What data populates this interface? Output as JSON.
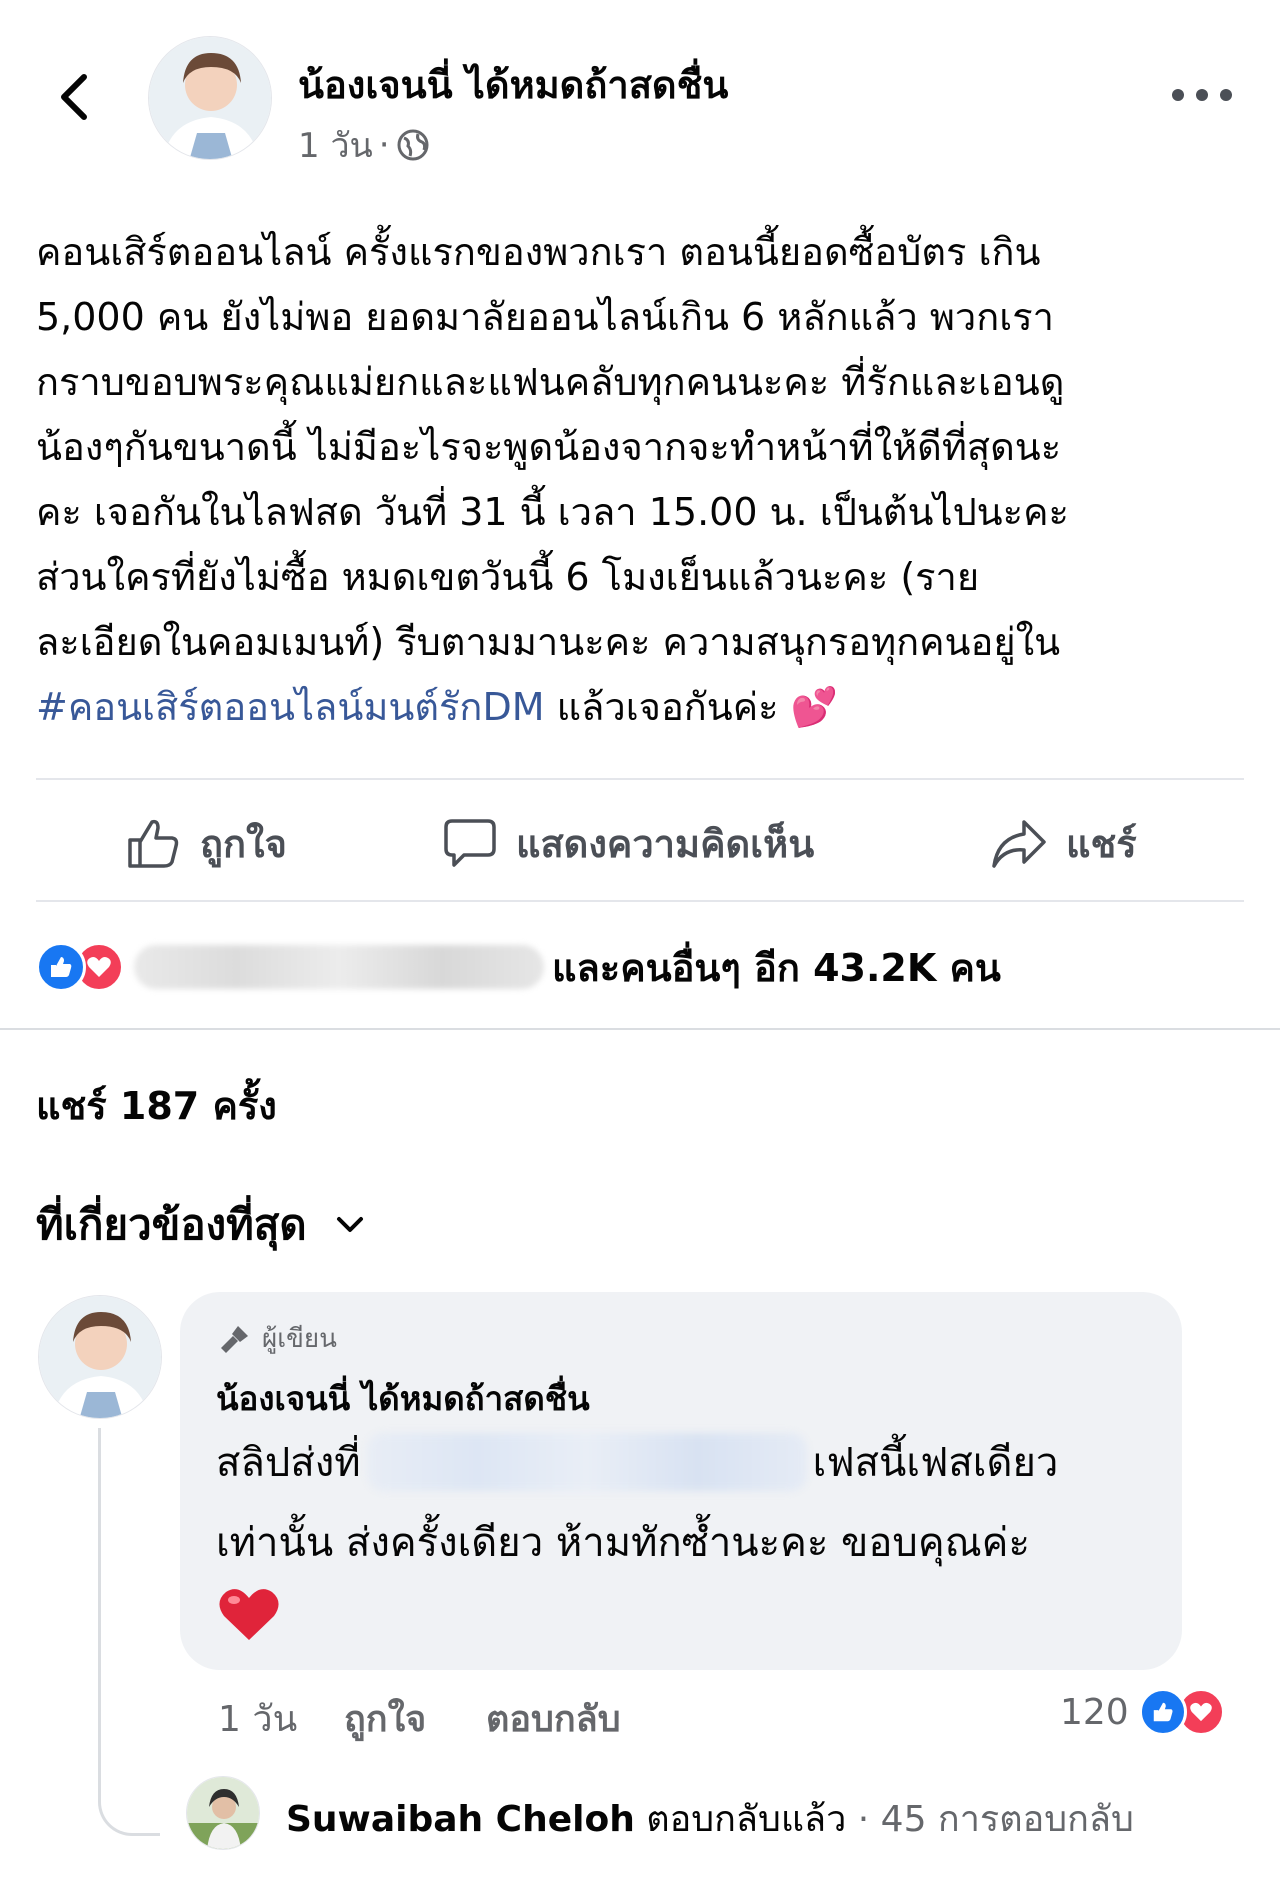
{
  "header": {
    "back_icon": "chevron-left-icon",
    "author_name": "น้องเจนนี่ ได้หมดถ้าสดชื่น",
    "time": "1 วัน",
    "separator": "·",
    "privacy_icon": "globe-icon",
    "more_icon": "more-horizontal-icon"
  },
  "post": {
    "lines": [
      "คอนเสิร์ตออนไลน์ ครั้งแรกของพวกเรา ตอนนี้ยอดซื้อบัตร เกิน",
      "5,000 คน ยังไม่พอ ยอดมาลัยออนไลน์เกิน 6 หลักแล้ว พวกเรา",
      "กราบขอบพระคุณแม่ยกและแฟนคลับทุกคนนะคะ ที่รักและเอนดู",
      "น้องๆกันขนาดนี้ ไม่มีอะไรจะพูดน้องจากจะทำหน้าที่ให้ดีที่สุดนะ",
      "คะ เจอกันในไลฟสด วันที่ 31 นี้ เวลา 15.00 น. เป็นต้นไปนะคะ",
      "ส่วนใครที่ยังไม่ซื้อ หมดเขตวันนี้ 6 โมงเย็นแล้วนะคะ  (ราย",
      "ละเอียดในคอมเมนท์) รีบตามมานะคะ ความสนุกรอทุกคนอยู่ใน"
    ],
    "hashtag": "#คอนเสิร์ตออนไลน์มนต์รักDM",
    "last_line_suffix": " แล้วเจอกันค่ะ ",
    "emoji": "💕"
  },
  "actions": {
    "like_label": "ถูกใจ",
    "comment_label": "แสดงความคิดเห็น",
    "share_label": "แชร์"
  },
  "reactions": {
    "summary": "และคนอื่นๆ อีก 43.2K คน",
    "like_color": "#1877f2",
    "love_color": "#f33e58"
  },
  "shares": "แชร์ 187 ครั้ง",
  "sort": {
    "label": "ที่เกี่ยวข้องที่สุด"
  },
  "comment": {
    "badge": "ผู้เขียน",
    "author": "น้องเจนนี่ ได้หมดถ้าสดชื่น",
    "line1_start": "สลิปส่งที่",
    "line1_end": "เฟสนี้เฟสเดียว",
    "line2": "เท่านั้น ส่งครั้งเดียว ห้ามทักซ้ำนะคะ ขอบคุณค่ะ",
    "emoji": "❤️",
    "time": "1 วัน",
    "like_label": "ถูกใจ",
    "reply_label": "ตอบกลับ",
    "reaction_count": "120"
  },
  "reply": {
    "name": "Suwaibah Cheloh",
    "action": " ตอบกลับแล้ว",
    "count": " · 45 การตอบกลับ"
  },
  "colors": {
    "text": "#050505",
    "secondary": "#65676b",
    "hashtag": "#385898",
    "bubble": "#f0f2f5"
  }
}
